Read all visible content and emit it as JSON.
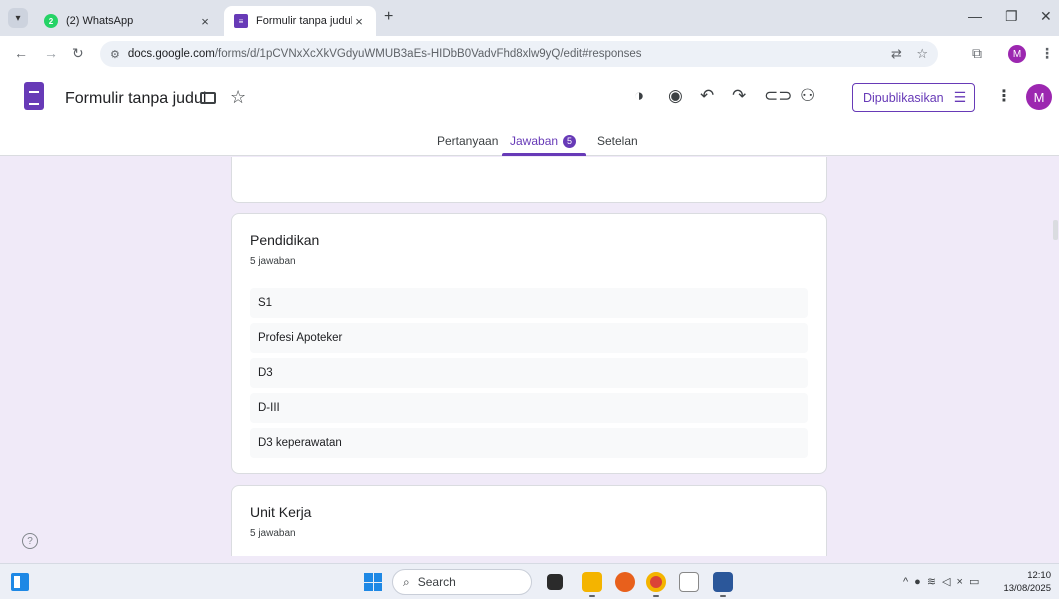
{
  "browser": {
    "tabs": [
      {
        "title": "(2) WhatsApp",
        "badge": "2",
        "active": false
      },
      {
        "title": "Formulir tanpa judul - Google F",
        "active": true
      }
    ],
    "url_host": "docs.google.com",
    "url_path": "/forms/d/1pCVNxXcXkVGdyuWMUB3aEs-HIDbB0VadvFhd8xlw9yQ/edit#responses",
    "profile_initial": "M"
  },
  "form": {
    "title": "Formulir tanpa judul",
    "publish_label": "Dipublikasikan",
    "avatar_initial": "M",
    "tabs": {
      "questions": "Pertanyaan",
      "responses": "Jawaban",
      "responses_count": "5",
      "settings": "Setelan"
    }
  },
  "questions": [
    {
      "title": "Pendidikan",
      "count": "5 jawaban",
      "answers": [
        "S1",
        "Profesi Apoteker",
        "D3",
        "D-III",
        "D3 keperawatan"
      ]
    },
    {
      "title": "Unit Kerja",
      "count": "5 jawaban"
    }
  ],
  "taskbar": {
    "search_placeholder": "Search",
    "time": "12:10",
    "date": "13/08/2025"
  },
  "colors": {
    "accent": "#673ab7",
    "page_bg": "#f0eaf8",
    "pie": "#3366cc"
  }
}
